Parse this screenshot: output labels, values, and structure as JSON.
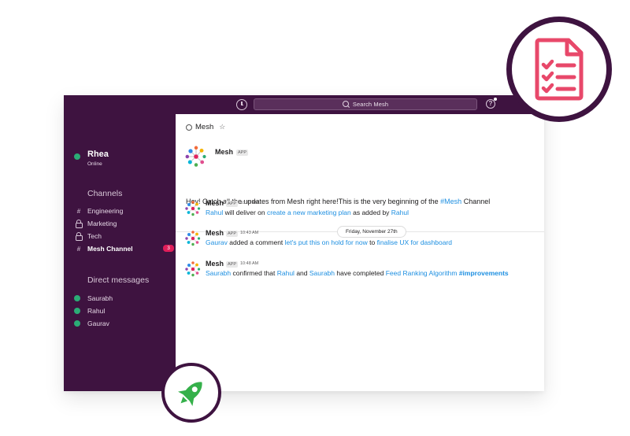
{
  "window": {
    "search_placeholder": "Search Mesh"
  },
  "sidebar": {
    "user": {
      "name": "Rhea",
      "status": "Online"
    },
    "channels_title": "Channels",
    "channels": [
      {
        "label": "Engineering",
        "icon": "hash-icon"
      },
      {
        "label": "Marketing",
        "icon": "lock-icon"
      },
      {
        "label": "Tech",
        "icon": "lock-icon"
      },
      {
        "label": "Mesh Channel",
        "icon": "hash-icon",
        "badge": "3",
        "active": true
      }
    ],
    "dm_title": "Direct messages",
    "dms": [
      {
        "label": "Saurabh"
      },
      {
        "label": "Rahul"
      },
      {
        "label": "Gaurav"
      }
    ]
  },
  "main": {
    "channel_name": "Mesh",
    "intro": {
      "sender": "Mesh",
      "tag": "APP",
      "text_before": "Hey! Catch all the updates from Mesh right here!This is the very beginning of the ",
      "channel_link": "#Mesh",
      "text_after": " Channel"
    },
    "date_divider": "Friday, November 27th",
    "messages": [
      {
        "sender": "Mesh",
        "tag": "APP",
        "time": "10:22 AM",
        "parts": [
          {
            "t": "Rahul",
            "link": true
          },
          {
            "t": " will deliver on "
          },
          {
            "t": "create a new marketing plan",
            "link": true
          },
          {
            "t": " as added by "
          },
          {
            "t": "Rahul",
            "link": true
          }
        ]
      },
      {
        "sender": "Mesh",
        "tag": "APP",
        "time": "10:43 AM",
        "parts": [
          {
            "t": "Gaurav",
            "link": true
          },
          {
            "t": " added a comment "
          },
          {
            "t": "let's put this on hold for now",
            "link": true
          },
          {
            "t": " to "
          },
          {
            "t": "finalise UX for dashboard",
            "link": true
          }
        ]
      },
      {
        "sender": "Mesh",
        "tag": "APP",
        "time": "10:48 AM",
        "parts": [
          {
            "t": "Saurabh",
            "link": true
          },
          {
            "t": " confirmed that "
          },
          {
            "t": "Rahul",
            "link": true
          },
          {
            "t": " and "
          },
          {
            "t": "Saurabh",
            "link": true
          },
          {
            "t": " have completed "
          },
          {
            "t": "Feed Ranking Algorithm",
            "link": true
          },
          {
            "t": " "
          },
          {
            "t": "#improvements",
            "link": true,
            "bold": true
          }
        ]
      }
    ]
  },
  "colors": {
    "aubergine": "#3e1340",
    "online": "#2bac76",
    "badge": "#e01e5a",
    "link": "#1264a3",
    "doc_icon": "#e8486a",
    "rocket_icon": "#35b04a"
  },
  "decor": {
    "top_right_badge_icon": "checklist-document-icon",
    "bottom_badge_icon": "rocket-icon"
  }
}
